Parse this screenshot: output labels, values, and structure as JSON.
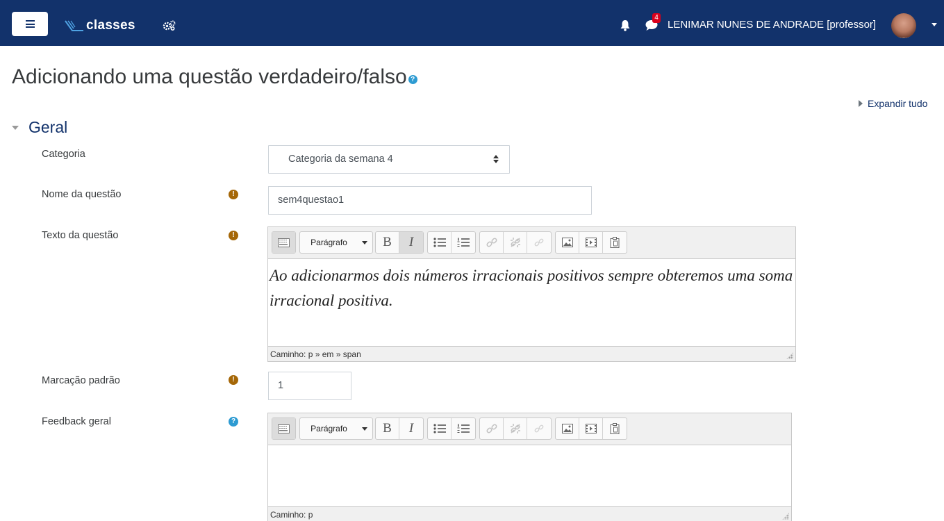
{
  "navbar": {
    "brand": "classes",
    "notification_count": "4",
    "user_name": "LENIMAR NUNES DE ANDRADE [professor]"
  },
  "page": {
    "title": "Adicionando uma questão verdadeiro/falso",
    "expand_all": "Expandir tudo"
  },
  "section": {
    "title": "Geral"
  },
  "form": {
    "categoria": {
      "label": "Categoria",
      "value": "Categoria da semana 4"
    },
    "nome": {
      "label": "Nome da questão",
      "value": "sem4questao1"
    },
    "texto": {
      "label": "Texto da questão",
      "content": "Ao adicionarmos dois números irracionais positivos sempre obteremos uma soma irracional positiva.",
      "path": "Caminho: p » em » span"
    },
    "marcacao": {
      "label": "Marcação padrão",
      "value": "1"
    },
    "feedback": {
      "label": "Feedback geral",
      "content": "",
      "path": "Caminho: p"
    }
  },
  "editor_toolbar": {
    "format_label": "Parágrafo",
    "bold": "B",
    "italic": "I"
  },
  "colors": {
    "navbar_bg": "#12326b",
    "required_icon": "#a56707",
    "help_icon": "#2d9bd2",
    "notification_badge": "#d9001b"
  },
  "icons": [
    "menu-icon",
    "brand-logo-icon",
    "cog-icon",
    "bell-icon",
    "chat-icon",
    "avatar",
    "caret-down-icon",
    "help-icon",
    "required-icon",
    "toolbar-toggle-icon",
    "unordered-list-icon",
    "ordered-list-icon",
    "link-icon",
    "unlink-icon",
    "anchor-icon",
    "image-icon",
    "media-icon",
    "paste-icon"
  ]
}
